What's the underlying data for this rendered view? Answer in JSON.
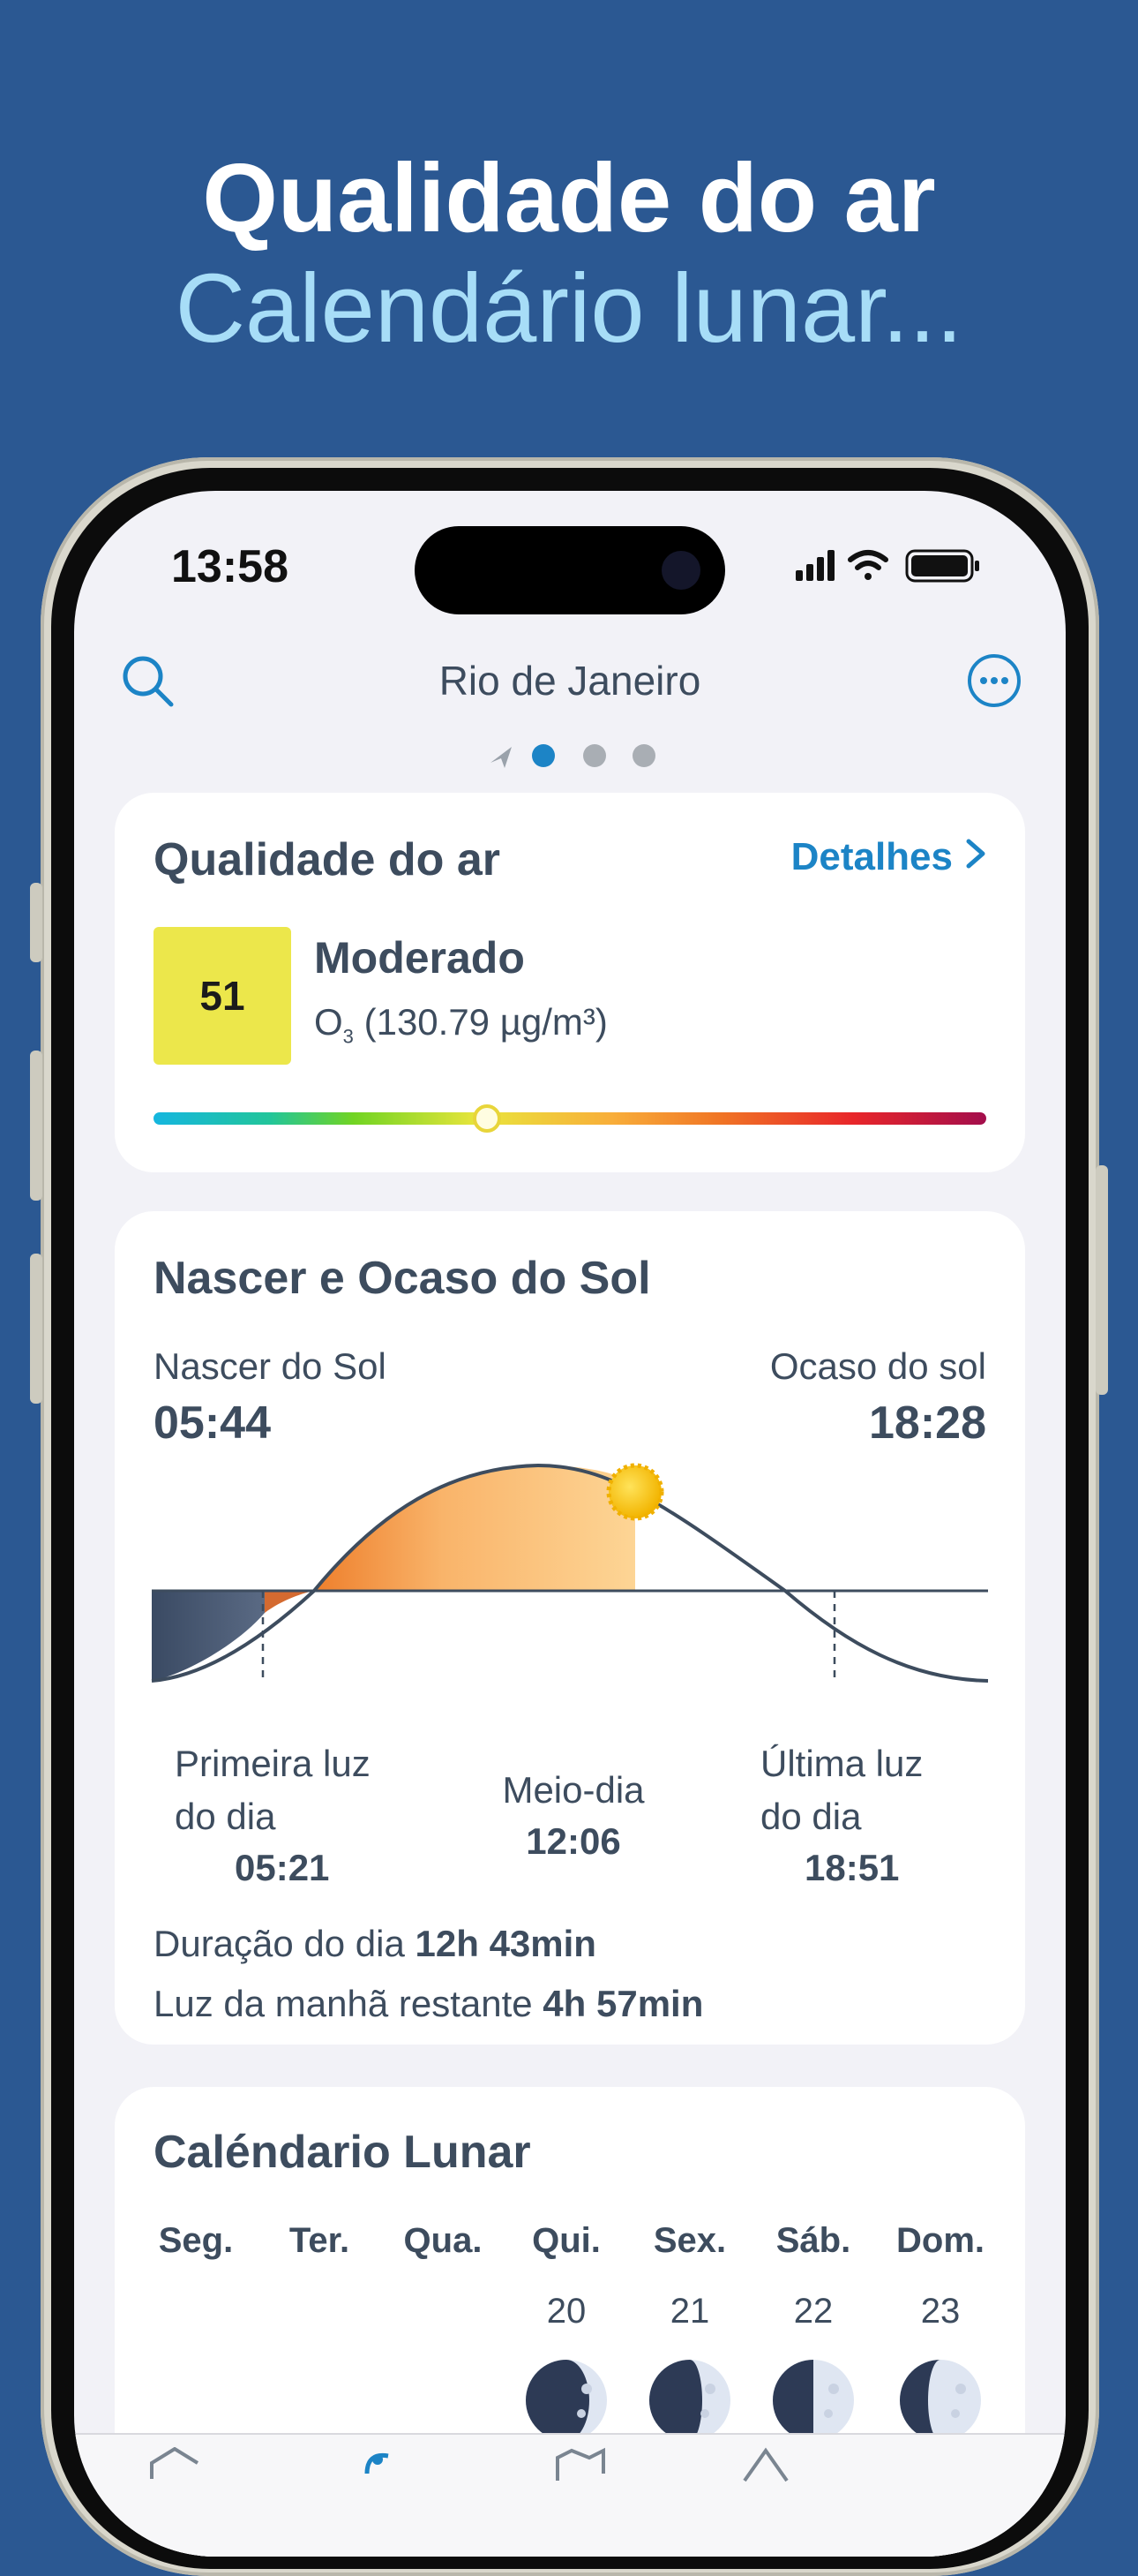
{
  "promo": {
    "line1": "Qualidade do ar",
    "line2": "Calendário lunar..."
  },
  "status_bar": {
    "time": "13:58"
  },
  "nav": {
    "title": "Rio de Janeiro",
    "icons": [
      "search-icon",
      "more-icon"
    ],
    "page_indicator": {
      "count": 3,
      "active": 0,
      "has_location_arrow": true
    }
  },
  "air_quality": {
    "title": "Qualidade do ar",
    "details_label": "Detalhes",
    "index": "51",
    "level": "Moderado",
    "pollutant": "O",
    "pollutant_sub": "3",
    "pollutant_value": "(130.79 µg/m³)",
    "scale_position_fraction": 0.4,
    "index_color": "#ece74b"
  },
  "sun": {
    "title": "Nascer e Ocaso do Sol",
    "sunrise_label": "Nascer do Sol",
    "sunrise_time": "05:44",
    "sunset_label": "Ocaso do sol",
    "sunset_time": "18:28",
    "first_light_label_1": "Primeira luz",
    "first_light_label_2": "do dia",
    "first_light_time": "05:21",
    "noon_label": "Meio-dia",
    "noon_time": "12:06",
    "last_light_label_1": "Última luz",
    "last_light_label_2": "do dia",
    "last_light_time": "18:51",
    "day_length_label": "Duração do dia",
    "day_length_value": "12h 43min",
    "remaining_label": "Luz da manhã restante",
    "remaining_value": "4h 57min"
  },
  "moon": {
    "title": "Caléndario Lunar",
    "days": [
      {
        "name": "Seg.",
        "num": ""
      },
      {
        "name": "Ter.",
        "num": ""
      },
      {
        "name": "Qua.",
        "num": ""
      },
      {
        "name": "Qui.",
        "num": "20"
      },
      {
        "name": "Sex.",
        "num": "21"
      },
      {
        "name": "Sáb.",
        "num": "22"
      },
      {
        "name": "Dom.",
        "num": "23"
      }
    ]
  },
  "colors": {
    "background": "#2b5892",
    "accent": "#1c84c6",
    "text": "#3d4c5e"
  }
}
